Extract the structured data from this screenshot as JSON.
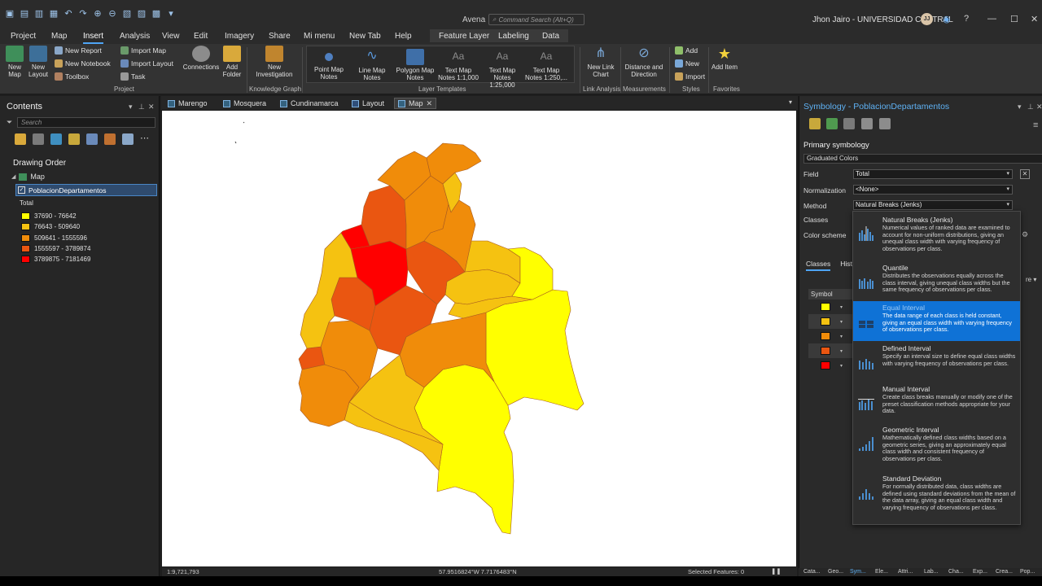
{
  "titlebar": {
    "app_name": "Avena",
    "command_search_placeholder": "Command Search (Alt+Q)",
    "user": "Jhon Jairo - UNIVERSIDAD CENTRAL",
    "avatar_initials": "JJ",
    "help": "?"
  },
  "ribbon_tabs": {
    "project": "Project",
    "map": "Map",
    "insert": "Insert",
    "analysis": "Analysis",
    "view": "View",
    "edit": "Edit",
    "imagery": "Imagery",
    "share": "Share",
    "mi_menu": "Mi menu",
    "new_tab": "New Tab",
    "help": "Help",
    "feature_layer": "Feature Layer",
    "labeling": "Labeling",
    "data": "Data"
  },
  "ribbon": {
    "new_map": "New Map",
    "new_layout": "New Layout",
    "new_report": "New Report",
    "new_notebook": "New Notebook",
    "toolbox": "Toolbox",
    "import_map": "Import Map",
    "import_layout": "Import Layout",
    "task": "Task",
    "connections": "Connections",
    "add_folder": "Add Folder",
    "group_project": "Project",
    "new_investigation": "New Investigation",
    "group_knowledge_graph": "Knowledge Graph",
    "point_map_notes": "Point Map Notes",
    "line_map_notes": "Line Map Notes",
    "polygon_map_notes": "Polygon Map Notes",
    "text_map_notes_1": "Text Map Notes 1:1,000",
    "text_map_notes_2": "Text Map Notes 1:25,000",
    "text_map_notes_3": "Text Map Notes 1:250,...",
    "group_layer_templates": "Layer Templates",
    "new_link_chart": "New Link Chart",
    "group_link_analysis": "Link Analysis",
    "distance_direction": "Distance and Direction",
    "group_measurements": "Measurements",
    "add": "Add",
    "new": "New",
    "import": "Import",
    "group_styles": "Styles",
    "add_item": "Add Item",
    "group_favorites": "Favorites"
  },
  "contents": {
    "title": "Contents",
    "search_placeholder": "Search",
    "drawing_order": "Drawing Order",
    "map_label": "Map",
    "layer_name": "PoblacionDepartamentos",
    "field_label": "Total",
    "legend": [
      {
        "label": "37690 - 76642",
        "color": "#ffff00"
      },
      {
        "label": "76643 - 509640",
        "color": "#f5c211"
      },
      {
        "label": "509641 - 1555596",
        "color": "#f08c0a"
      },
      {
        "label": "1555597 - 3789874",
        "color": "#ea5611"
      },
      {
        "label": "3789875 - 7181469",
        "color": "#ff0000"
      }
    ]
  },
  "view_tabs": {
    "marengo": "Marengo",
    "mosquera": "Mosquera",
    "cundinamarca": "Cundinamarca",
    "layout": "Layout",
    "map": "Map"
  },
  "status": {
    "scale": "1:9,721,793",
    "coordinates": "57.9516824°W 7.7176483°N",
    "selected": "Selected Features: 0"
  },
  "symbology": {
    "title": "Symbology - PoblacionDepartamentos",
    "primary_label": "Primary symbology",
    "primary_value": "Graduated Colors",
    "field_label": "Field",
    "field_value": "Total",
    "normalization_label": "Normalization",
    "normalization_value": "<None>",
    "method_label": "Method",
    "method_value": "Natural Breaks (Jenks)",
    "classes_label": "Classes",
    "color_scheme_label": "Color scheme",
    "tab_classes": "Classes",
    "tab_histogram": "Histo",
    "symbol_header": "Symbol",
    "side_more": "re",
    "symbols": [
      "#ffff00",
      "#f5c211",
      "#f08c0a",
      "#ea5611",
      "#ff0000"
    ]
  },
  "methods": [
    {
      "name": "Natural Breaks (Jenks)",
      "desc": "Numerical values of ranked data are examined to account for non-uniform distributions, giving an unequal class width with varying frequency of observations per class.",
      "selected": false
    },
    {
      "name": "Quantile",
      "desc": "Distributes the observations equally across the class interval, giving unequal class widths but the same frequency of observations per class.",
      "selected": false
    },
    {
      "name": "Equal Interval",
      "desc": "The data range of each class is held constant, giving an equal class width with varying frequency of observations per class.",
      "selected": true
    },
    {
      "name": "Defined Interval",
      "desc": "Specify an interval size to define equal class widths with varying frequency of observations per class.",
      "selected": false
    },
    {
      "name": "Manual Interval",
      "desc": "Create class breaks manually or modify one of the preset classification methods appropriate for your data.",
      "selected": false
    },
    {
      "name": "Geometric Interval",
      "desc": "Mathematically defined class widths based on a geometric series, giving an approximately equal class width and consistent frequency of observations per class.",
      "selected": false
    },
    {
      "name": "Standard Deviation",
      "desc": "For normally distributed data, class widths are defined using standard deviations from the mean of the data array, giving an equal class width and varying frequency of observations per class.",
      "selected": false
    }
  ],
  "bottom_tabs": {
    "t1": "Cata...",
    "t2": "Geo...",
    "t3": "Sym...",
    "t4": "Ele...",
    "t5": "Attri...",
    "t6": "Lab...",
    "t7": "Cha...",
    "t8": "Exp...",
    "t9": "Crea...",
    "t10": "Pop..."
  }
}
